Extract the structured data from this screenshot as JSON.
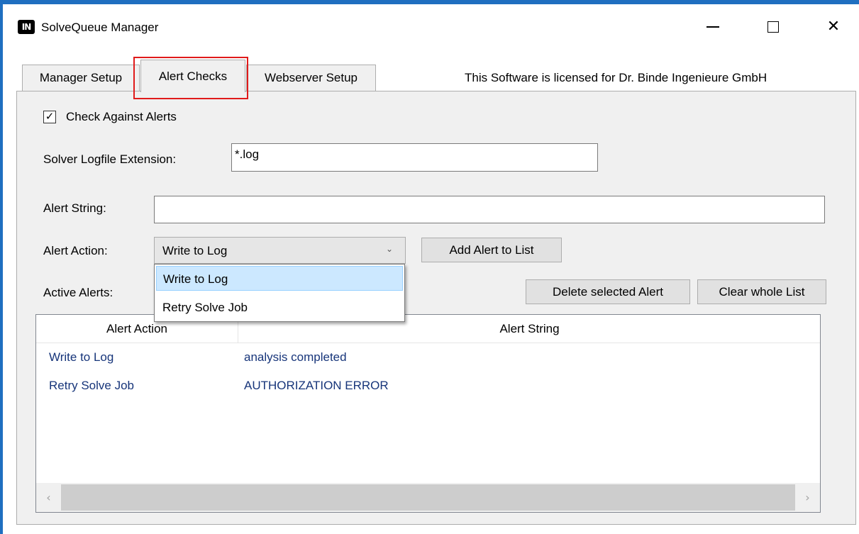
{
  "window": {
    "title": "SolveQueue Manager",
    "icon_text": "IN",
    "icon": "app-logo-icon",
    "controls": {
      "minimize": "minimize-icon",
      "maximize": "maximize-icon",
      "close": "close-icon",
      "close_glyph": "✕"
    }
  },
  "tabs": [
    {
      "label": "Manager Setup",
      "selected": false
    },
    {
      "label": "Alert Checks",
      "selected": true
    },
    {
      "label": "Webserver Setup",
      "selected": false
    }
  ],
  "license_text": "This Software is licensed for Dr. Binde Ingenieure GmbH",
  "form": {
    "check_against_alerts": {
      "label": "Check Against Alerts",
      "checked": true,
      "mark": "✓"
    },
    "logfile_extension": {
      "label": "Solver Logfile Extension:",
      "value": "*.log"
    },
    "alert_string": {
      "label": "Alert String:",
      "value": ""
    },
    "alert_action": {
      "label": "Alert Action:",
      "selected": "Write to Log",
      "chevron": "⌄",
      "options": [
        "Write to Log",
        "Retry Solve Job"
      ],
      "dropdown_open": true
    },
    "add_button": "Add Alert to List"
  },
  "active_alerts": {
    "label": "Active Alerts:",
    "delete_button": "Delete selected Alert",
    "clear_button": "Clear whole List",
    "columns": [
      "Alert Action",
      "Alert String"
    ],
    "rows": [
      {
        "action": "Write to Log",
        "string": "analysis completed"
      },
      {
        "action": "Retry Solve Job",
        "string": "AUTHORIZATION ERROR"
      }
    ],
    "scroll_left": "‹",
    "scroll_right": "›"
  },
  "colors": {
    "frame": "#1f6fc0",
    "highlight": "#e01b1b",
    "list_text": "#17357a",
    "selected_option": "#cce8ff"
  }
}
